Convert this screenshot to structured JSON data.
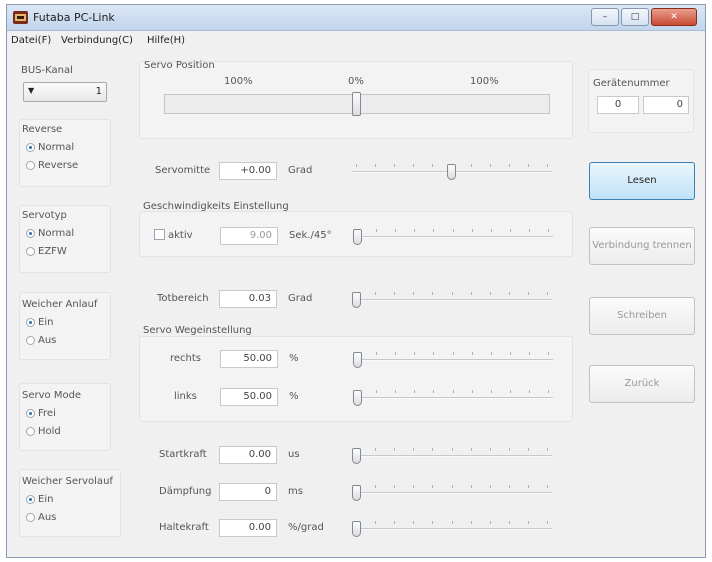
{
  "window": {
    "title": "Futaba PC-Link",
    "min": "–",
    "max": "□",
    "close": "✕"
  },
  "menu": [
    "Datei(F)",
    "Verbindung(C)",
    "Hilfe(H)"
  ],
  "bus_kanal": {
    "label": "BUS-Kanal",
    "value": "1"
  },
  "reverse": {
    "label": "Reverse",
    "options": [
      "Normal",
      "Reverse"
    ],
    "selected": 0
  },
  "servotyp": {
    "label": "Servotyp",
    "options": [
      "Normal",
      "EZFW"
    ],
    "selected": 0
  },
  "weicher_anlauf": {
    "label": "Weicher Anlauf",
    "options": [
      "Ein",
      "Aus"
    ],
    "selected": 0
  },
  "servo_mode": {
    "label": "Servo Mode",
    "options": [
      "Frei",
      "Hold"
    ],
    "selected": 0
  },
  "weicher_servolauf": {
    "label": "Weicher Servolauf",
    "options": [
      "Ein",
      "Aus"
    ],
    "selected": 0
  },
  "servo_position": {
    "label": "Servo Position",
    "scale_left": "100%",
    "scale_mid": "0%",
    "scale_right": "100%",
    "value_fraction": 0.5
  },
  "servomitte": {
    "label": "Servomitte",
    "value": "+0.00",
    "unit": "Grad",
    "slider_fraction": 0.5
  },
  "geschwindigkeit": {
    "label": "Geschwindigkeits Einstellung",
    "aktiv_label": "aktiv",
    "aktiv_checked": false,
    "value": "9.00",
    "unit": "Sek./45°",
    "slider_fraction": 0.0
  },
  "totbereich": {
    "label": "Totbereich",
    "value": "0.03",
    "unit": "Grad",
    "slider_fraction": 0.0
  },
  "wegeinstellung": {
    "label": "Servo Wegeinstellung",
    "rechts": {
      "label": "rechts",
      "value": "50.00",
      "unit": "%",
      "slider_fraction": 0.0
    },
    "links": {
      "label": "links",
      "value": "50.00",
      "unit": "%",
      "slider_fraction": 0.0
    }
  },
  "startkraft": {
    "label": "Startkraft",
    "value": "0.00",
    "unit": "us",
    "slider_fraction": 0.0
  },
  "daempfung": {
    "label": "Dämpfung",
    "value": "0",
    "unit": "ms",
    "slider_fraction": 0.0
  },
  "haltekraft": {
    "label": "Haltekraft",
    "value": "0.00",
    "unit": "%/grad",
    "slider_fraction": 0.0
  },
  "geraetenummer": {
    "label": "Gerätenummer",
    "left": "0",
    "right": "0"
  },
  "buttons": {
    "lesen": "Lesen",
    "verbindung": "Verbindung trennen",
    "schreiben": "Schreiben",
    "zurueck": "Zurück"
  },
  "colors": {
    "primary_button": "#bfe2f8",
    "close_button": "#c94a33",
    "radio_dot": "#2a6fb4"
  }
}
